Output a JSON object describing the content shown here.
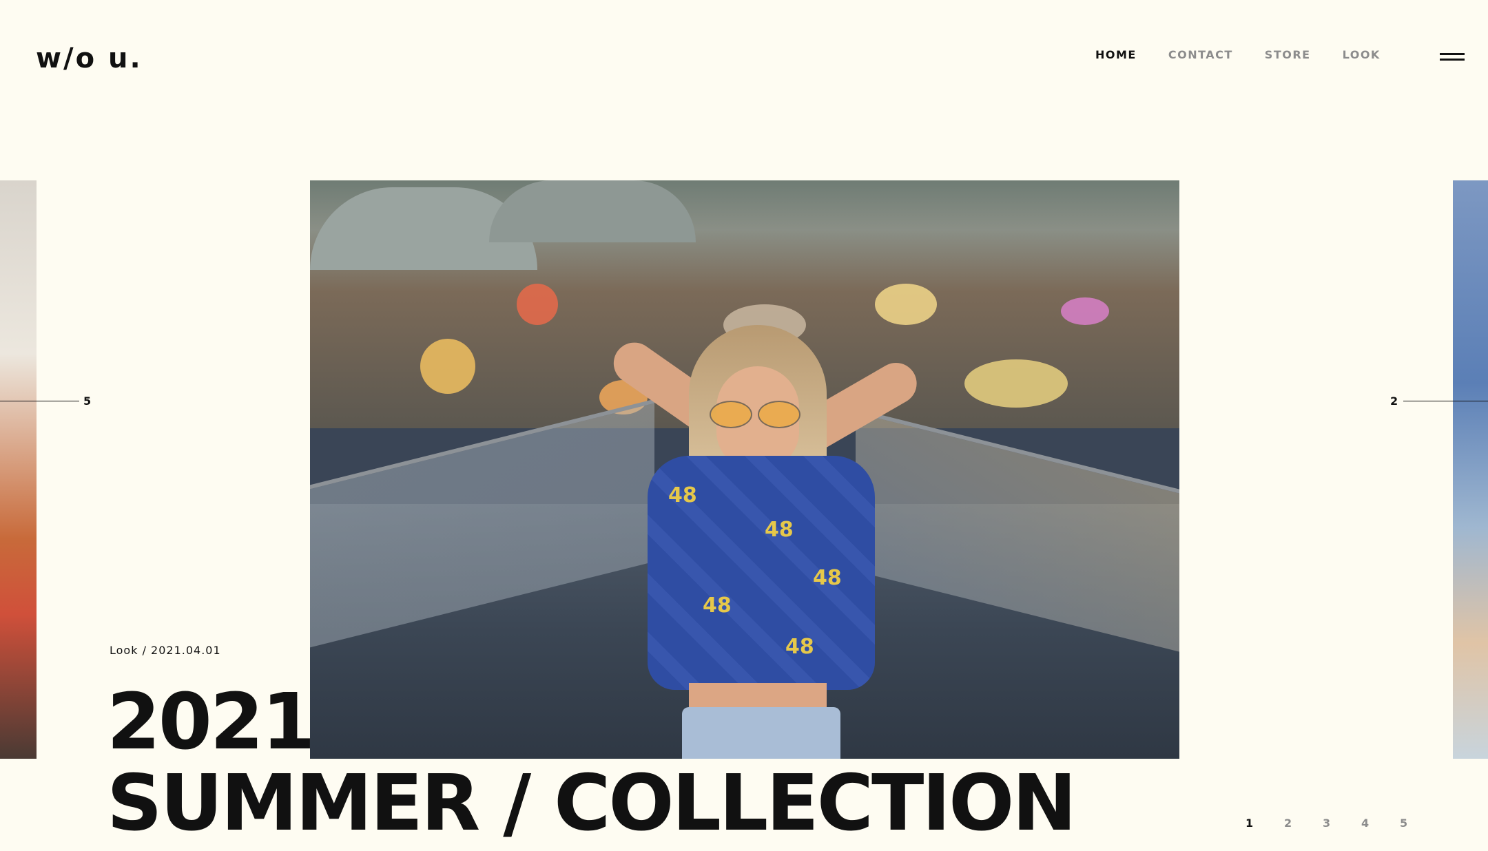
{
  "header": {
    "logo": "w/o u.",
    "nav": [
      "HOME",
      "CONTACT",
      "STORE",
      "LOOK"
    ],
    "active_nav": "HOME"
  },
  "slider": {
    "prev_index": "5",
    "next_index": "2",
    "shirt_number": "48"
  },
  "caption": {
    "meta": "Look / 2021.04.01",
    "title_line1": "2021",
    "title_line2": "SUMMER / COLLECTION"
  },
  "pagination": {
    "pages": [
      "1",
      "2",
      "3",
      "4",
      "5"
    ],
    "current": "1"
  },
  "colors": {
    "background": "#fefcf2",
    "text": "#111111",
    "nav_inactive": "#8c8c8c"
  }
}
